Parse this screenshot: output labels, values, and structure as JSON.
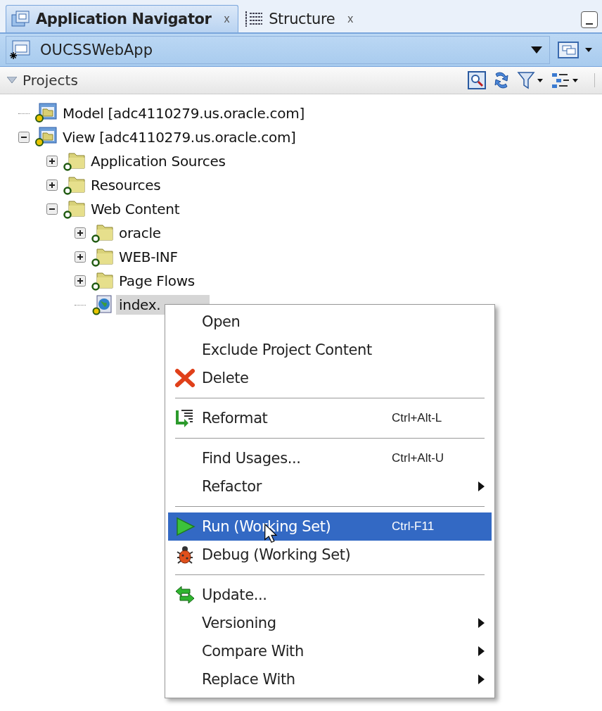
{
  "tabs": [
    {
      "label": "Application Navigator",
      "selected": true,
      "close": "x"
    },
    {
      "label": "Structure",
      "selected": false,
      "close": "x"
    }
  ],
  "app_selector": {
    "value": "OUCSSWebApp"
  },
  "projects_header": {
    "label": "Projects",
    "expanded": true
  },
  "tree": [
    {
      "label": "Model [adc4110279.us.oracle.com]",
      "kind": "project",
      "selected": false
    },
    {
      "label": "View [adc4110279.us.oracle.com]",
      "kind": "project",
      "selected": false,
      "expanded": true,
      "children": [
        {
          "label": "Application Sources",
          "kind": "folder",
          "selected": false,
          "expanded": false
        },
        {
          "label": "Resources",
          "kind": "folder",
          "selected": false,
          "expanded": false
        },
        {
          "label": "Web Content",
          "kind": "folder",
          "selected": false,
          "expanded": true,
          "children": [
            {
              "label": "oracle",
              "kind": "folder",
              "selected": false,
              "expanded": false
            },
            {
              "label": "WEB-INF",
              "kind": "folder",
              "selected": false,
              "expanded": false
            },
            {
              "label": "Page Flows",
              "kind": "folder",
              "selected": false,
              "expanded": false
            },
            {
              "label": "index.",
              "kind": "file",
              "selected": true
            }
          ]
        }
      ]
    }
  ],
  "context_menu": [
    {
      "kind": "plain",
      "label": "Open",
      "selected": false,
      "submenu": false
    },
    {
      "kind": "plain",
      "label": "Exclude Project Content",
      "selected": false,
      "submenu": false
    },
    {
      "kind": "delete",
      "label": "Delete",
      "selected": false,
      "submenu": false
    },
    {
      "kind": "separator"
    },
    {
      "kind": "reformat",
      "label": "Reformat",
      "shortcut": "Ctrl+Alt-L",
      "selected": false,
      "submenu": false
    },
    {
      "kind": "separator"
    },
    {
      "kind": "plain",
      "label": "Find Usages...",
      "shortcut": "Ctrl+Alt-U",
      "selected": false,
      "submenu": false
    },
    {
      "kind": "plain",
      "label": "Refactor",
      "selected": false,
      "submenu": true
    },
    {
      "kind": "separator"
    },
    {
      "kind": "run",
      "label": "Run (Working Set)",
      "shortcut": "Ctrl-F11",
      "selected": true,
      "submenu": false
    },
    {
      "kind": "debug",
      "label": "Debug (Working Set)",
      "selected": false,
      "submenu": false
    },
    {
      "kind": "separator"
    },
    {
      "kind": "update",
      "label": "Update...",
      "selected": false,
      "submenu": false
    },
    {
      "kind": "plain",
      "label": "Versioning",
      "selected": false,
      "submenu": true
    },
    {
      "kind": "plain",
      "label": "Compare With",
      "selected": false,
      "submenu": true
    },
    {
      "kind": "plain",
      "label": "Replace With",
      "selected": false,
      "submenu": true
    }
  ]
}
